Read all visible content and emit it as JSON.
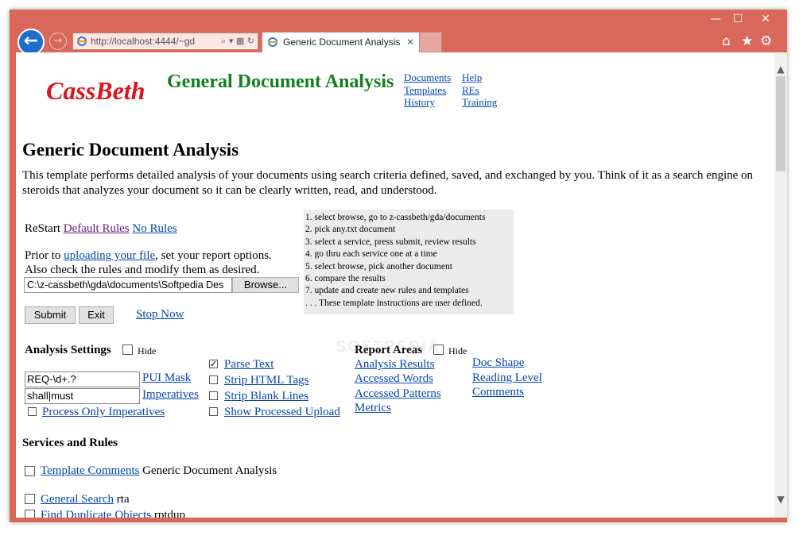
{
  "browser": {
    "address": "http://localhost:4444/~gd",
    "tab_title": "Generic Document Analysis",
    "window_controls": {
      "minimize": "—",
      "maximize": "☐",
      "close": "✕"
    }
  },
  "header": {
    "logo": "CassBeth",
    "app_title": "General Document Analysis",
    "nav_col1": [
      "Documents",
      "Templates",
      "History"
    ],
    "nav_col2": [
      "Help",
      "REs",
      "Training"
    ]
  },
  "page": {
    "title": "Generic Document Analysis",
    "intro": "This template performs detailed analysis of your documents using search criteria defined, saved, and exchanged by you. Think of it as a search engine on steroids that analyzes your document so it can be clearly written, read, and understood."
  },
  "restart": {
    "label": "ReStart",
    "default_rules": "Default Rules",
    "no_rules": "No Rules"
  },
  "prior": {
    "text1": "Prior to",
    "link": "uploading your file",
    "text2": ", set your report options.",
    "line2": "Also check the rules and modify them as desired."
  },
  "upload": {
    "file_value": "C:\\z-cassbeth\\gda\\documents\\Softpedia Des",
    "browse": "Browse...",
    "submit": "Submit",
    "exit": "Exit",
    "stop_now": "Stop Now"
  },
  "instructions": [
    "1. select browse, go to z-cassbeth/gda/documents",
    "2. pick any.txt document",
    "3. select a service, press submit, review results",
    "4. go thru each service one at a time",
    "5. select browse, pick another document",
    "6. compare the results",
    "7. update and create new rules and templates",
    ". . . These template instructions are user defined."
  ],
  "analysis_settings": {
    "title": "Analysis Settings",
    "hide": "Hide",
    "pui_value": "REQ-\\d+.?",
    "pui_link": "PUI Mask",
    "imp_value": "shall|must",
    "imp_link": "Imperatives",
    "process_only": "Process Only Imperatives",
    "parse_text": "Parse Text",
    "strip_html": "Strip HTML Tags",
    "strip_blank": "Strip Blank Lines",
    "show_processed": "Show Processed Upload"
  },
  "report_areas": {
    "title": "Report Areas",
    "hide": "Hide",
    "col1": [
      "Analysis Results",
      "Accessed Words",
      "Accessed Patterns",
      "Metrics"
    ],
    "col2": [
      "Doc Shape",
      "Reading Level",
      "Comments"
    ]
  },
  "services": {
    "title": "Services and Rules",
    "items": [
      {
        "link": "Template Comments",
        "desc": "Generic Document Analysis"
      },
      {
        "link": "General Search",
        "desc": "rta"
      },
      {
        "link": "Find Duplicate Objects",
        "desc": "rptdup"
      }
    ]
  },
  "watermark": "SOFTPEDIA"
}
